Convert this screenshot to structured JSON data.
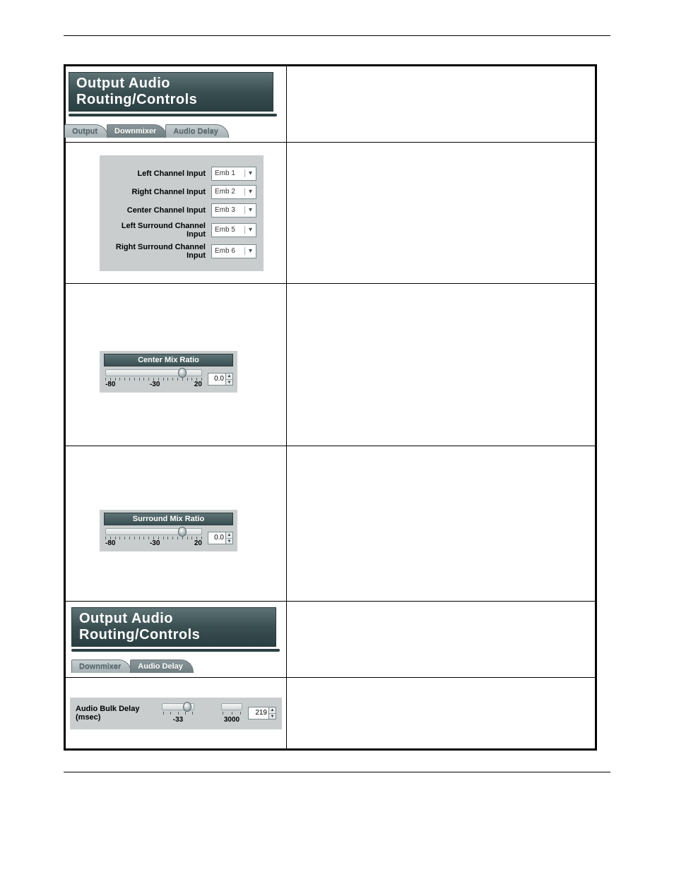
{
  "headings": {
    "section1": "Output Audio Routing/Controls",
    "section2": "Output Audio Routing/Controls"
  },
  "tabs1": {
    "output": "Output",
    "downmixer": "Downmixer",
    "audio_delay": "Audio Delay"
  },
  "tabs2": {
    "downmixer": "Downmixer",
    "audio_delay": "Audio Delay"
  },
  "inputs": {
    "left": {
      "label": "Left Channel Input",
      "value": "Emb 1"
    },
    "right": {
      "label": "Right Channel Input",
      "value": "Emb 2"
    },
    "center": {
      "label": "Center Channel Input",
      "value": "Emb 3"
    },
    "ls": {
      "label": "Left Surround Channel Input",
      "value": "Emb 5"
    },
    "rs": {
      "label": "Right Surround Channel Input",
      "value": "Emb 6"
    }
  },
  "center_mix": {
    "title": "Center Mix Ratio",
    "value": "0.0",
    "scale_min": "-80",
    "scale_mid": "-30",
    "scale_max": "20",
    "thumb_pct": 80
  },
  "surround_mix": {
    "title": "Surround Mix Ratio",
    "value": "0.0",
    "scale_min": "-80",
    "scale_mid": "-30",
    "scale_max": "20",
    "thumb_pct": 80
  },
  "bulk_delay": {
    "label": "Audio Bulk Delay (msec)",
    "value": "219",
    "scale_min": "-33",
    "scale_max": "3000",
    "thumb_left_pct": 80
  }
}
